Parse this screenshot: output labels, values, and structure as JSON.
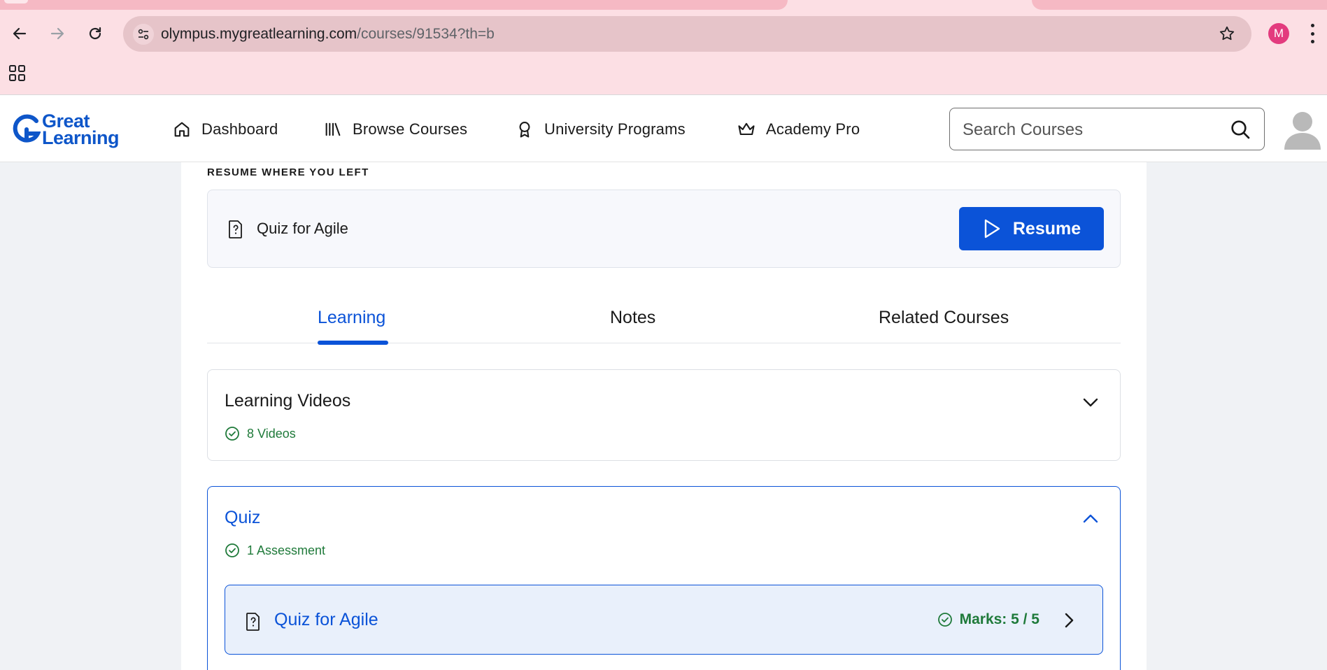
{
  "browser": {
    "url_host": "olympus.mygreatlearning.com",
    "url_path": "/courses/91534?th=b",
    "profile_initial": "M"
  },
  "header": {
    "logo_line1": "Great",
    "logo_line2": "Learning",
    "nav": [
      {
        "label": "Dashboard",
        "icon": "home-icon"
      },
      {
        "label": "Browse Courses",
        "icon": "library-icon"
      },
      {
        "label": "University Programs",
        "icon": "award-icon"
      },
      {
        "label": "Academy Pro",
        "icon": "crown-icon"
      }
    ],
    "search_placeholder": "Search Courses"
  },
  "resume": {
    "caption": "RESUME WHERE YOU LEFT",
    "item_title": "Quiz for Agile",
    "button_label": "Resume"
  },
  "tabs": [
    {
      "label": "Learning",
      "active": true
    },
    {
      "label": "Notes",
      "active": false
    },
    {
      "label": "Related Courses",
      "active": false
    }
  ],
  "sections": [
    {
      "title": "Learning Videos",
      "meta": "8 Videos",
      "expanded": false
    },
    {
      "title": "Quiz",
      "meta": "1 Assessment",
      "expanded": true,
      "items": [
        {
          "title": "Quiz for Agile",
          "marks": "Marks: 5 / 5"
        }
      ]
    }
  ],
  "colors": {
    "accent": "#0b53d8",
    "success": "#1f7a3a",
    "browser_bg": "#fcdfe4"
  }
}
